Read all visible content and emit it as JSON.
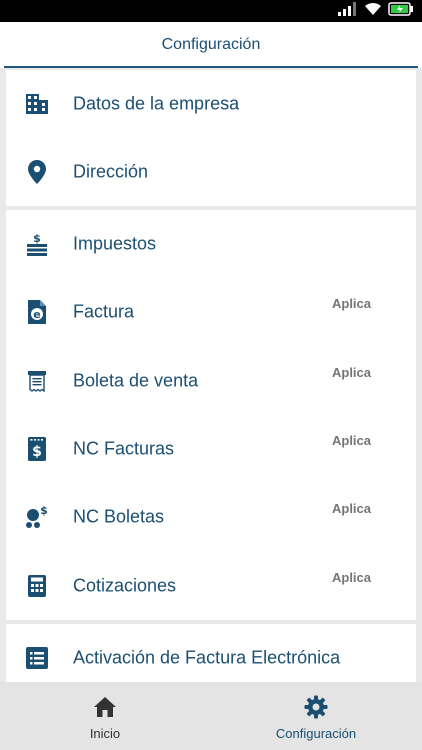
{
  "header": {
    "title": "Configuración"
  },
  "sections": [
    {
      "items": [
        {
          "label": "Datos de la empresa",
          "icon": "building-icon"
        },
        {
          "label": "Dirección",
          "icon": "location-pin-icon"
        }
      ]
    },
    {
      "items": [
        {
          "label": "Impuestos",
          "icon": "money-stack-icon"
        },
        {
          "label": "Factura",
          "icon": "e-invoice-icon",
          "tag": "Aplica"
        },
        {
          "label": "Boleta de venta",
          "icon": "receipt-icon",
          "tag": "Aplica"
        },
        {
          "label": "NC Facturas",
          "icon": "dollar-document-icon",
          "tag": "Aplica"
        },
        {
          "label": "NC Boletas",
          "icon": "coins-icon",
          "tag": "Aplica"
        },
        {
          "label": "Cotizaciones",
          "icon": "calculator-icon",
          "tag": "Aplica"
        }
      ]
    },
    {
      "items": [
        {
          "label": "Activación de Factura Electrónica",
          "icon": "checklist-icon"
        }
      ]
    }
  ],
  "bottom_nav": [
    {
      "label": "Inicio",
      "icon": "home-icon",
      "active": false
    },
    {
      "label": "Configuración",
      "icon": "gear-icon",
      "active": true
    }
  ],
  "colors": {
    "primary": "#1b4f72",
    "tag": "#757575",
    "nav_inactive": "#333333",
    "nav_bg": "#e4e4e4",
    "battery": "#2ecc40"
  }
}
